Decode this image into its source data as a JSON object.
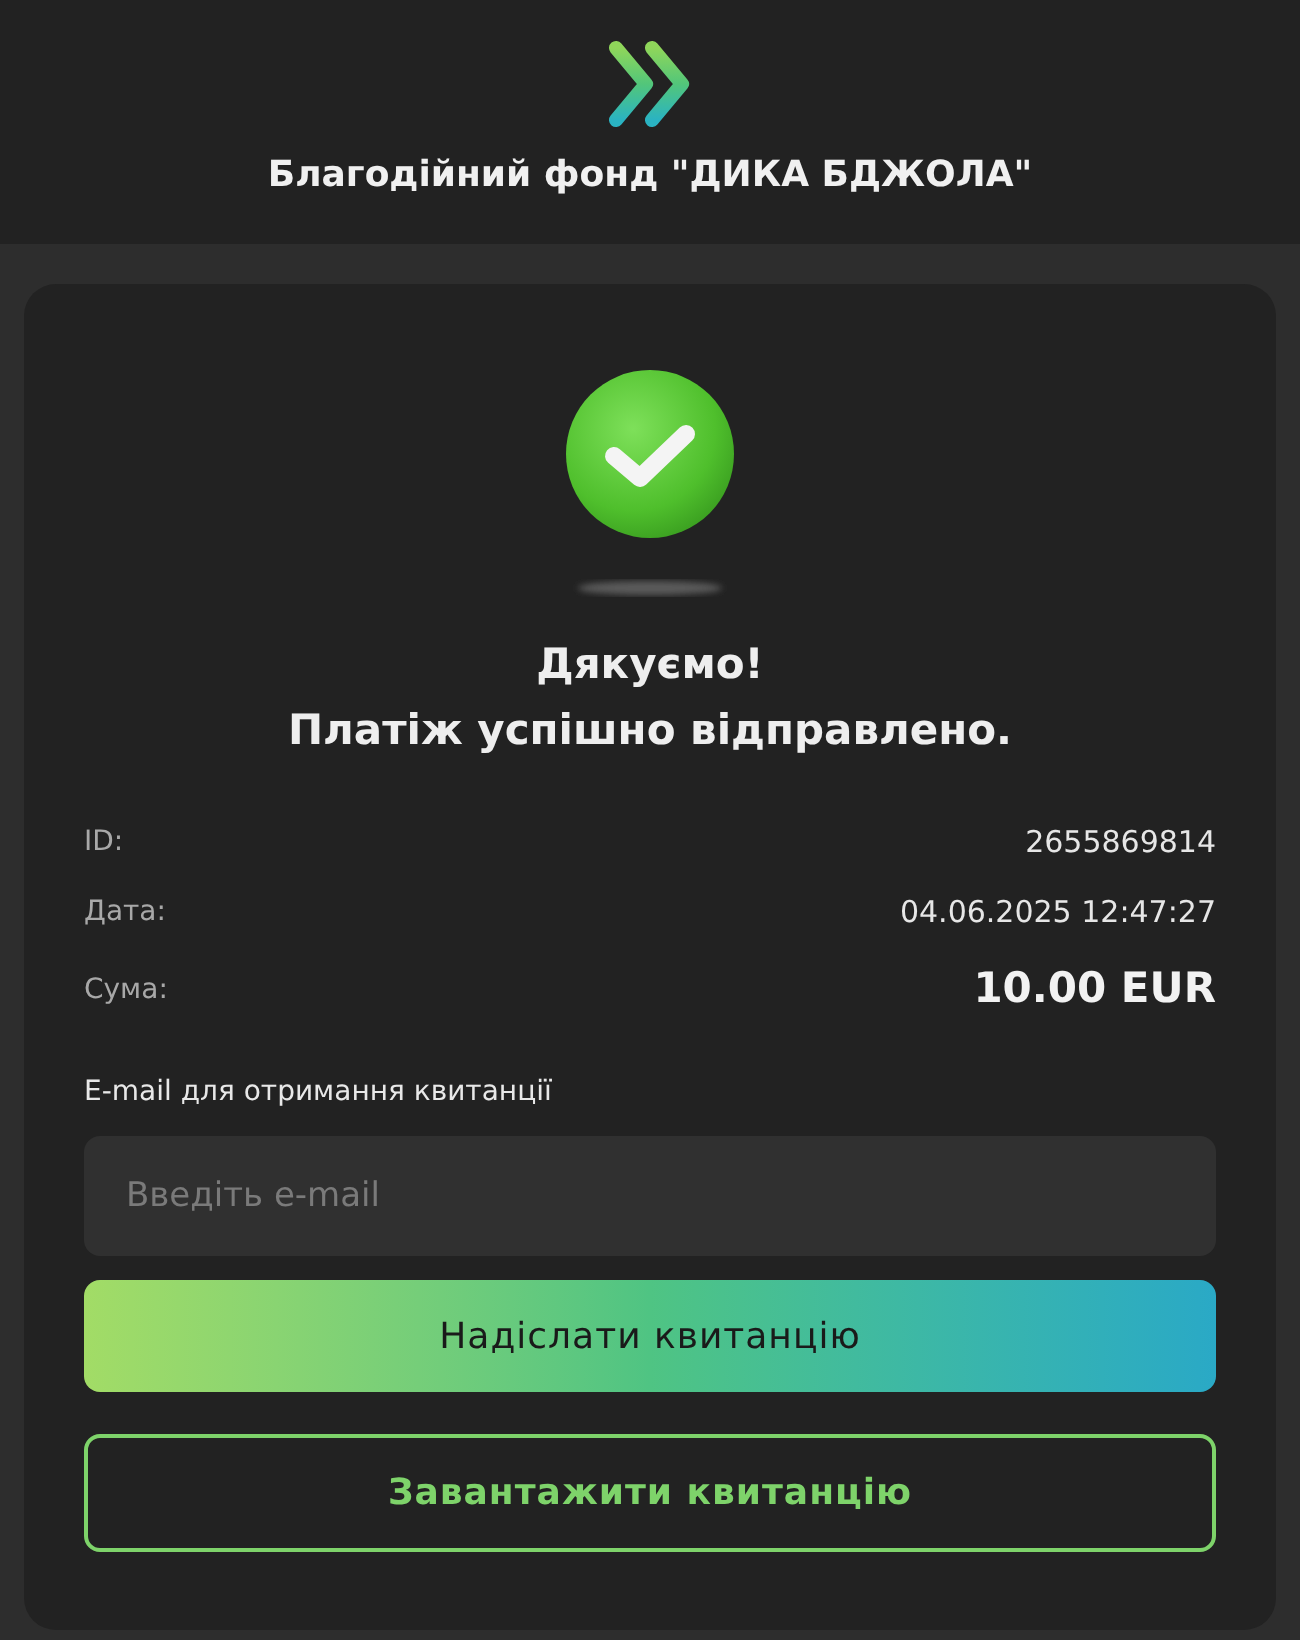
{
  "header": {
    "title": "Благодійний фонд \"ДИКА БДЖОЛА\""
  },
  "status": {
    "kind": "success",
    "heading": "Дякуємо!",
    "message": "Платіж успішно відправлено."
  },
  "details": [
    {
      "label": "ID:",
      "value": "2655869814",
      "kind": "text"
    },
    {
      "label": "Дата:",
      "value": "04.06.2025 12:47:27",
      "kind": "text"
    },
    {
      "label": "Сума:",
      "value": "10.00 EUR",
      "kind": "amount"
    }
  ],
  "email": {
    "label": "E-mail для отримання квитанції",
    "placeholder": "Введіть e-mail"
  },
  "buttons": [
    {
      "label": "Надіслати квитанцію",
      "kind": "primary"
    },
    {
      "label": "Завантажити квитанцію",
      "kind": "outline"
    }
  ]
}
